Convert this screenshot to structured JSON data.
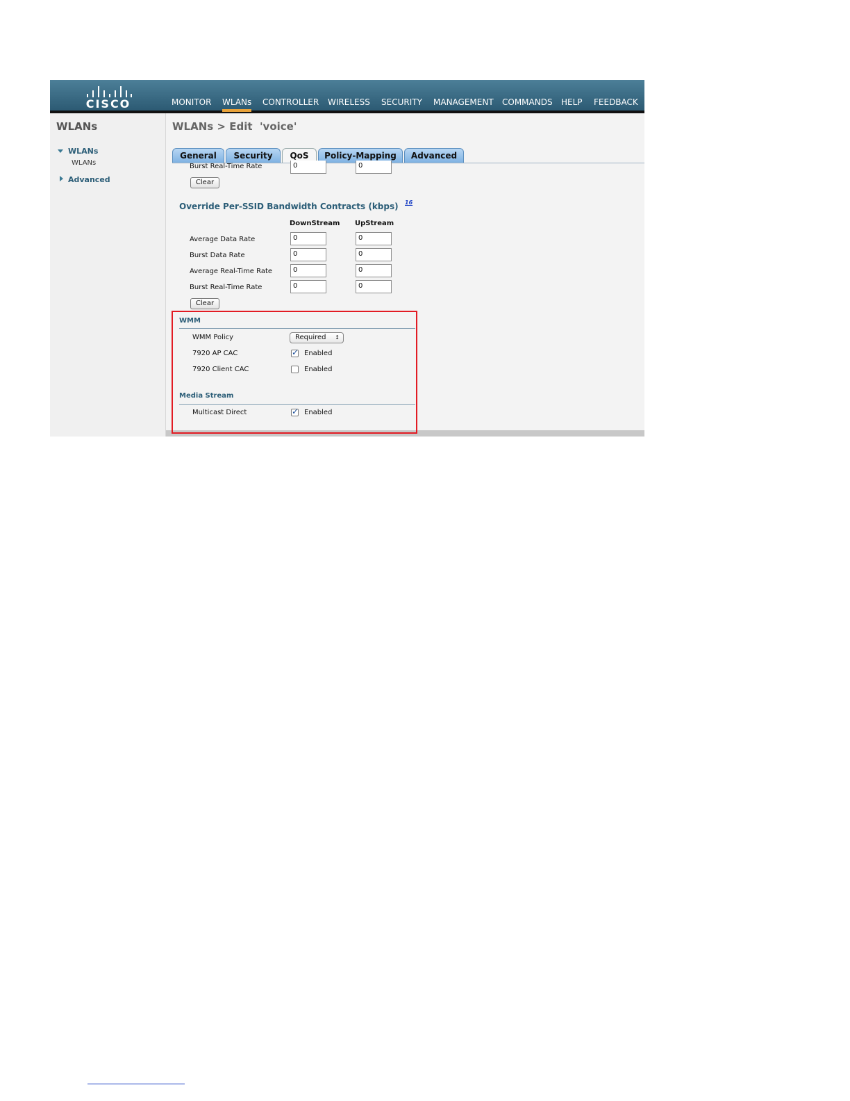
{
  "header": {
    "logo_text": "CISCO",
    "nav": [
      {
        "label": "MONITOR",
        "active": false
      },
      {
        "label": "WLANs",
        "active": true
      },
      {
        "label": "CONTROLLER",
        "active": false
      },
      {
        "label": "WIRELESS",
        "active": false
      },
      {
        "label": "SECURITY",
        "active": false
      },
      {
        "label": "MANAGEMENT",
        "active": false
      },
      {
        "label": "COMMANDS",
        "active": false
      },
      {
        "label": "HELP",
        "active": false
      },
      {
        "label": "FEEDBACK",
        "active": false
      }
    ]
  },
  "sidebar": {
    "title": "WLANs",
    "items": [
      {
        "label": "WLANs",
        "expanded": true,
        "children": [
          "WLANs"
        ]
      },
      {
        "label": "Advanced",
        "expanded": false
      }
    ]
  },
  "breadcrumb": "WLANs > Edit  'voice'",
  "tabs": [
    {
      "label": "General",
      "active": false
    },
    {
      "label": "Security",
      "active": false
    },
    {
      "label": "QoS",
      "active": true
    },
    {
      "label": "Policy-Mapping",
      "active": false
    },
    {
      "label": "Advanced",
      "active": false
    }
  ],
  "top_partial": {
    "label": "Burst Real-Time Rate",
    "downstream": "0",
    "upstream": "0",
    "clear_label": "Clear"
  },
  "override": {
    "title": "Override Per-SSID Bandwidth Contracts (kbps)",
    "footnote": "16",
    "col_downstream": "DownStream",
    "col_upstream": "UpStream",
    "rows": [
      {
        "label": "Average Data Rate",
        "downstream": "0",
        "upstream": "0"
      },
      {
        "label": "Burst Data Rate",
        "downstream": "0",
        "upstream": "0"
      },
      {
        "label": "Average Real-Time Rate",
        "downstream": "0",
        "upstream": "0"
      },
      {
        "label": "Burst Real-Time Rate",
        "downstream": "0",
        "upstream": "0"
      }
    ],
    "clear_label": "Clear"
  },
  "wmm": {
    "title": "WMM",
    "policy_label": "WMM Policy",
    "policy_value": "Required",
    "ap_cac_label": "7920 AP CAC",
    "ap_cac_checked": true,
    "ap_cac_text": "Enabled",
    "client_cac_label": "7920 Client CAC",
    "client_cac_checked": false,
    "client_cac_text": "Enabled"
  },
  "media_stream": {
    "title": "Media Stream",
    "multicast_label": "Multicast Direct",
    "multicast_checked": true,
    "multicast_text": "Enabled"
  },
  "colors": {
    "header_top": "#4c7f98",
    "header_bottom": "#2c5a73",
    "active_underline": "#e8a23a",
    "section_title": "#2b5d77",
    "tab_fill": "#9cc4ec",
    "highlight_box": "#e21b23"
  }
}
